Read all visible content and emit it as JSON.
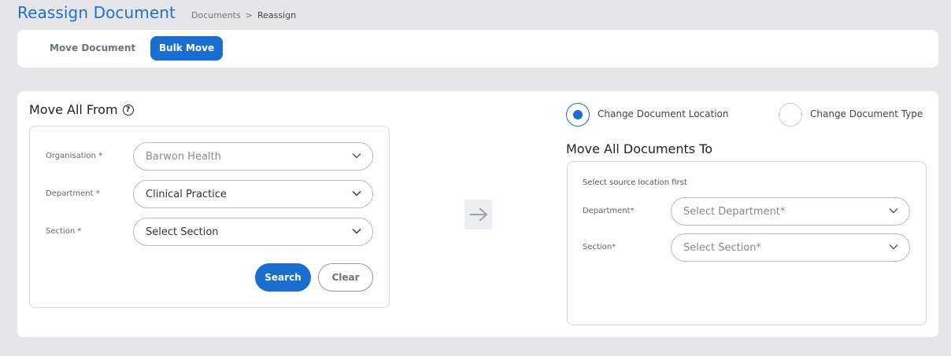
{
  "header": {
    "title": "Reassign Document",
    "breadcrumb": {
      "items": [
        "Documents",
        "Reassign"
      ],
      "separator": ">"
    }
  },
  "tabs": {
    "move_document": "Move Document",
    "bulk_move": "Bulk Move",
    "active": "Bulk Move"
  },
  "from": {
    "title": "Move All From",
    "help_icon": "question-circle-icon",
    "organisation": {
      "label": "Organisation *",
      "value": "Barwon Health",
      "disabled": true
    },
    "department": {
      "label": "Department *",
      "value": "Clinical Practice"
    },
    "section": {
      "label": "Section *",
      "placeholder": "Select Section"
    },
    "search_label": "Search",
    "clear_label": "Clear"
  },
  "arrow_icon": "arrow-right-icon",
  "options": {
    "change_location": {
      "label": "Change Document Location",
      "selected": true
    },
    "change_type": {
      "label": "Change Document Type",
      "selected": false
    }
  },
  "to": {
    "title": "Move All Documents To",
    "hint": "Select source location first",
    "department": {
      "label": "Department*",
      "placeholder": "Select Department*"
    },
    "section": {
      "label": "Section*",
      "placeholder": "Select Section*"
    }
  },
  "colors": {
    "accent": "#1a6ecf",
    "background": "#e6e6e8"
  }
}
